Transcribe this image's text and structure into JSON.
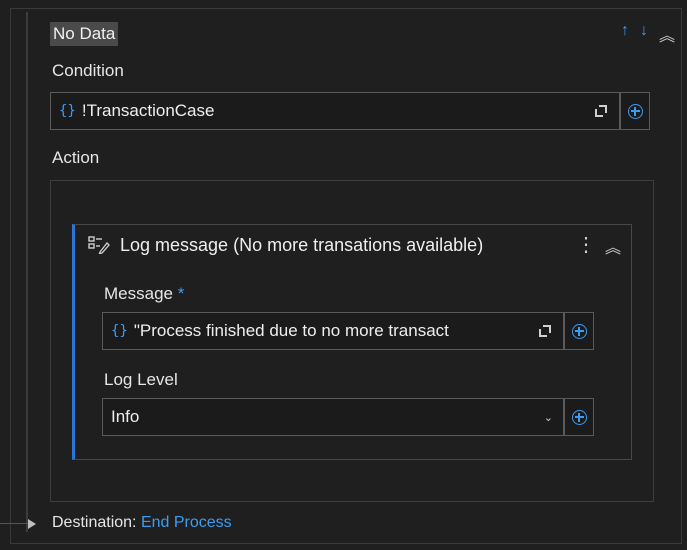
{
  "case": {
    "title": "No Data"
  },
  "condition": {
    "label": "Condition",
    "value": "!TransactionCase"
  },
  "action": {
    "label": "Action",
    "activity": {
      "title": "Log message (No more transations available)",
      "message_label": "Message",
      "required_marker": "*",
      "message_value": "\"Process finished due to no more transact",
      "log_level_label": "Log Level",
      "log_level_value": "Info"
    }
  },
  "destination": {
    "label": "Destination:",
    "value": "End Process"
  },
  "icons": {
    "move_up": "↑",
    "move_down": "↓",
    "collapse": "︽",
    "more": "⋮",
    "dropdown": "⌄"
  },
  "colors": {
    "accent": "#3d9bf0",
    "background": "#1f1f1f",
    "selection_bar": "#2a74d6"
  }
}
